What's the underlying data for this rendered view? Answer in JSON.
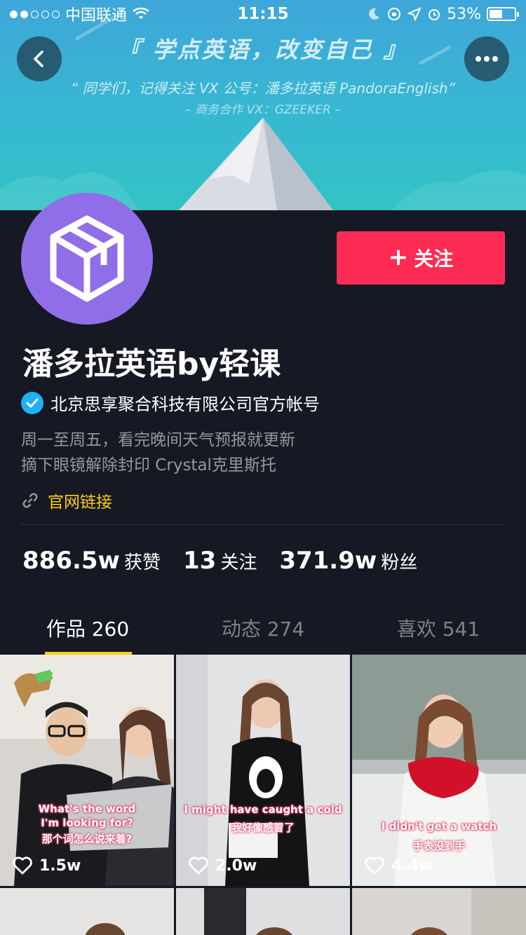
{
  "status_bar": {
    "carrier": "中国联通",
    "time": "11:15",
    "battery": "53%",
    "signal_filled": 2,
    "signal_total": 5
  },
  "banner": {
    "title": "『 学点英语，改变自己 』",
    "subtitle": "“ 同学们，记得关注 VX 公号：潘多拉英语 PandoraEnglish”",
    "business": "– 商务合作 VX：GZEEKER –"
  },
  "icons": {
    "back": "chevron-left-icon",
    "more": "ellipsis-icon",
    "avatar": "cube-icon",
    "verified": "check-badge-icon",
    "link": "link-icon",
    "heart": "heart-outline-icon"
  },
  "profile": {
    "follow_label": "关注",
    "name": "潘多拉英语by轻课",
    "verified_text": "北京思享聚合科技有限公司官方帐号",
    "bio_lines": [
      "周一至周五，看完晚间天气预报就更新",
      "摘下眼镜解除封印 Crystal克里斯托"
    ],
    "link_label": "官网链接"
  },
  "stats": [
    {
      "num": "886.5w",
      "label": "获赞"
    },
    {
      "num": "13",
      "label": "关注"
    },
    {
      "num": "371.9w",
      "label": "粉丝"
    }
  ],
  "tabs": [
    {
      "label": "作品 260",
      "active": true
    },
    {
      "label": "动态 274",
      "active": false
    },
    {
      "label": "喜欢 541",
      "active": false
    }
  ],
  "videos": [
    {
      "caption_en": "What's the word\nI'm looking for?",
      "caption_zh": "那个词怎么说来着?",
      "likes": "1.5w"
    },
    {
      "caption_en": "I might have caught a cold",
      "caption_zh": "我好像感冒了",
      "likes": "2.0w"
    },
    {
      "caption_en": "I didn't get a watch",
      "caption_zh": "手表没到手",
      "likes": "4.4w"
    }
  ],
  "colors": {
    "accent_follow": "#fe2c55",
    "accent_yellow": "#face15",
    "background": "#161823",
    "avatar_bg": "#8f6ee8",
    "verified_blue": "#20b0f5"
  }
}
